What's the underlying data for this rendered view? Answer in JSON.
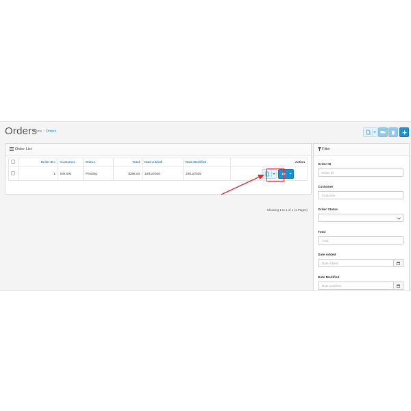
{
  "header": {
    "title": "Orders",
    "breadcrumb": [
      "Home",
      "Orders"
    ]
  },
  "order_list": {
    "title": "Order List",
    "columns": {
      "order_id": "Order ID",
      "customer": "Customer",
      "status": "Status",
      "total": "Total",
      "date_added": "Date Added",
      "date_modified": "Date Modified",
      "action": "Action"
    },
    "rows": [
      {
        "order_id": "1",
        "customer": "test test",
        "status": "Pending",
        "total": "$296.00",
        "date_added": "19/11/2025",
        "date_modified": "19/11/2025"
      }
    ],
    "pagination_text": "Showing 1 to 1 of 1 (1 Pages)"
  },
  "filter": {
    "title": "Filter",
    "order_id_label": "Order ID",
    "order_id_placeholder": "Order ID",
    "customer_label": "Customer",
    "customer_placeholder": "Customer",
    "order_status_label": "Order Status",
    "order_status_value": "",
    "total_label": "Total",
    "total_placeholder": "Total",
    "date_added_label": "Date Added",
    "date_added_placeholder": "Date Added",
    "date_modified_label": "Date Modified",
    "date_modified_placeholder": "Date Modified"
  },
  "colors": {
    "accent": "#1e91cf",
    "highlight": "#e3262b"
  }
}
